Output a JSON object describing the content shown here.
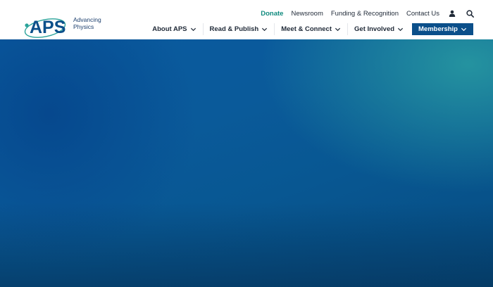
{
  "brand": {
    "logo_text": "APS",
    "tagline_line1": "Advancing",
    "tagline_line2": "Physics",
    "colors": {
      "logo_blue": "#0b4f8a",
      "logo_teal": "#2aa39a",
      "accent_teal": "#0f8a7e",
      "membership_bg": "#0b4f8a"
    }
  },
  "utility_nav": {
    "donate": "Donate",
    "newsroom": "Newsroom",
    "funding": "Funding & Recognition",
    "contact": "Contact Us",
    "account_icon": "person-icon",
    "search_icon": "search-icon"
  },
  "main_nav": {
    "items": [
      {
        "label": "About APS"
      },
      {
        "label": "Read & Publish"
      },
      {
        "label": "Meet & Connect"
      },
      {
        "label": "Get Involved"
      }
    ],
    "membership": "Membership"
  }
}
